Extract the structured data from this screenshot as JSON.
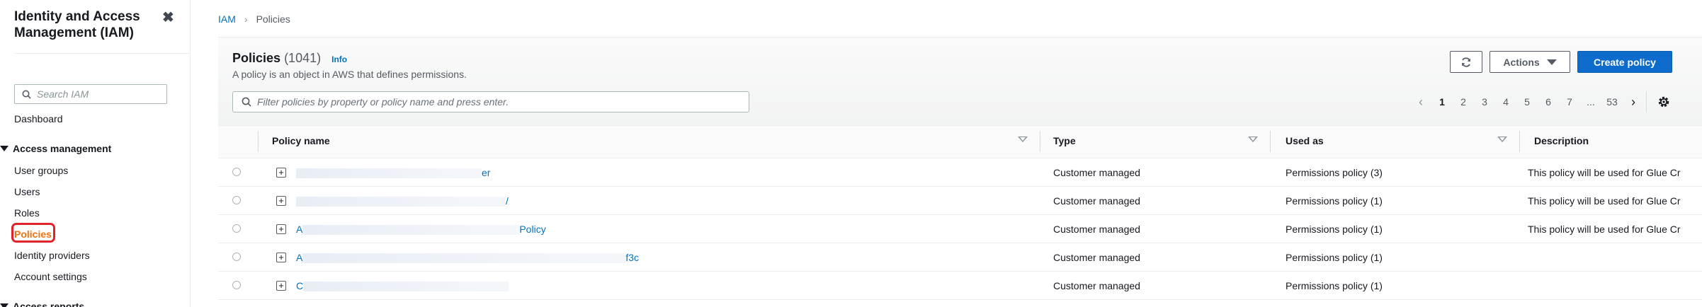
{
  "sidebar": {
    "title": "Identity and Access Management (IAM)",
    "search_placeholder": "Search IAM",
    "dashboard": "Dashboard",
    "section_access_management": "Access management",
    "items": [
      "User groups",
      "Users",
      "Roles",
      "Policies",
      "Identity providers",
      "Account settings"
    ],
    "active_item": "Policies",
    "section_access_reports": "Access reports"
  },
  "breadcrumb": {
    "root": "IAM",
    "current": "Policies"
  },
  "header": {
    "title": "Policies",
    "count": "(1041)",
    "info": "Info",
    "description": "A policy is an object in AWS that defines permissions.",
    "actions_label": "Actions",
    "create_label": "Create policy",
    "filter_placeholder": "Filter policies by property or policy name and press enter."
  },
  "pagination": {
    "pages": [
      "1",
      "2",
      "3",
      "4",
      "5",
      "6",
      "7",
      "...",
      "53"
    ],
    "current": "1"
  },
  "table": {
    "columns": [
      "Policy name",
      "Type",
      "Used as",
      "Description"
    ],
    "rows": [
      {
        "name_prefix": "",
        "name_suffix": "er",
        "type": "Customer managed",
        "used_as": "Permissions policy (3)",
        "description": "This policy will be used for Glue Cr"
      },
      {
        "name_prefix": "",
        "name_suffix": "/",
        "type": "Customer managed",
        "used_as": "Permissions policy (1)",
        "description": "This policy will be used for Glue Cr"
      },
      {
        "name_prefix": "A",
        "name_suffix": "Policy",
        "type": "Customer managed",
        "used_as": "Permissions policy (1)",
        "description": "This policy will be used for Glue Cr"
      },
      {
        "name_prefix": "A",
        "name_suffix": "f3c",
        "type": "Customer managed",
        "used_as": "Permissions policy (1)",
        "description": ""
      },
      {
        "name_prefix": "C",
        "name_suffix": "",
        "type": "Customer managed",
        "used_as": "Permissions policy (1)",
        "description": ""
      }
    ]
  },
  "colors": {
    "link": "#0073bb",
    "active_nav": "#ec7211",
    "highlight_box": "#e0252a",
    "primary_button": "#0d6bcc"
  },
  "icons": [
    "close-icon",
    "search-icon",
    "refresh-icon",
    "caret-down-icon",
    "chevron-left-icon",
    "chevron-right-icon",
    "settings-gear-icon",
    "expand-plus-icon",
    "sort-icon"
  ]
}
